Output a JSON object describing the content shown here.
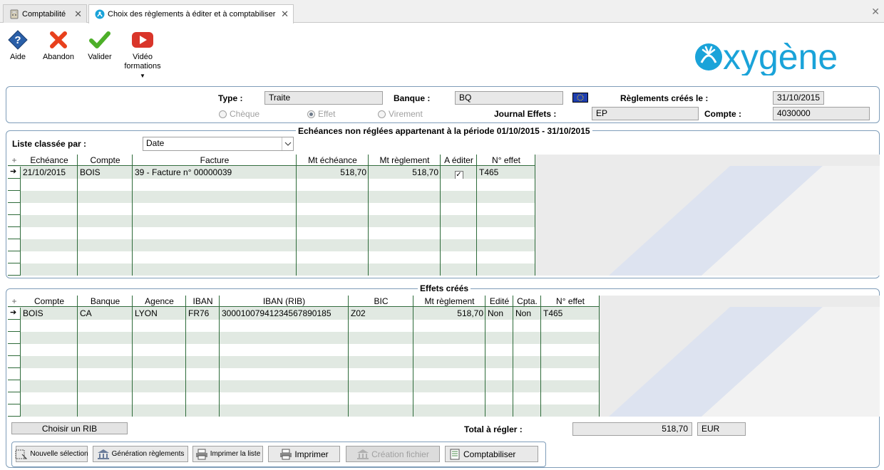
{
  "tabs": [
    {
      "label": "Comptabilité"
    },
    {
      "label": "Choix des règlements à éditer et à comptabiliser"
    }
  ],
  "toolbar": {
    "aide": "Aide",
    "abandon": "Abandon",
    "valider": "Valider",
    "video_line1": "Vidéo",
    "video_line2": "formations"
  },
  "logo": {
    "text": "oxygène",
    "color": "#1aa3d9"
  },
  "header": {
    "type_label": "Type :",
    "type_value": "Traite",
    "banque_label": "Banque :",
    "banque_value": "BQ",
    "reglements_label": "Règlements créés le :",
    "reglements_value": "31/10/2015",
    "radio_cheque": "Chèque",
    "radio_effet": "Effet",
    "radio_virement": "Virement",
    "journal_label": "Journal Effets :",
    "journal_value": "EP",
    "compte_label": "Compte :",
    "compte_value": "4030000"
  },
  "echeances": {
    "title": "Echéances non réglées appartenant à la période 01/10/2015 - 31/10/2015",
    "sort_label": "Liste classée par :",
    "sort_value": "Date",
    "columns": [
      "Echéance",
      "Compte",
      "Facture",
      "Mt échéance",
      "Mt règlement",
      "A éditer",
      "N° effet"
    ],
    "rows": [
      {
        "echeance": "21/10/2015",
        "compte": "BOIS",
        "facture": "39 - Facture n° 00000039",
        "mt_echeance": "518,70",
        "mt_reglement": "518,70",
        "a_editer": true,
        "n_effet": "T465"
      }
    ]
  },
  "effets": {
    "title": "Effets créés",
    "columns": [
      "Compte",
      "Banque",
      "Agence",
      "IBAN",
      "IBAN (RIB)",
      "BIC",
      "Mt règlement",
      "Edité",
      "Cpta.",
      "N° effet"
    ],
    "rows": [
      {
        "compte": "BOIS",
        "banque": "CA",
        "agence": "LYON",
        "iban": "FR76",
        "iban_rib": "30001007941234567890185",
        "bic": "Z02",
        "mt_reglement": "518,70",
        "edite": "Non",
        "cpta": "Non",
        "n_effet": "T465"
      }
    ]
  },
  "footer": {
    "choisir_rib": "Choisir un RIB",
    "total_label": "Total à régler :",
    "total_value": "518,70",
    "currency": "EUR"
  },
  "actions": {
    "nouvelle_selection": "Nouvelle sélection",
    "generation": "Génération règlements",
    "imprimer_liste": "Imprimer la liste",
    "imprimer": "Imprimer",
    "creation_fichier": "Création fichier",
    "comptabiliser": "Comptabiliser"
  },
  "colors": {
    "grid_line": "#2e6b3a",
    "panel_border": "#7f9db9",
    "abandon": "#e8401c",
    "valider": "#4caf28",
    "video": "#d9352a",
    "aide": "#2a5fa8"
  }
}
